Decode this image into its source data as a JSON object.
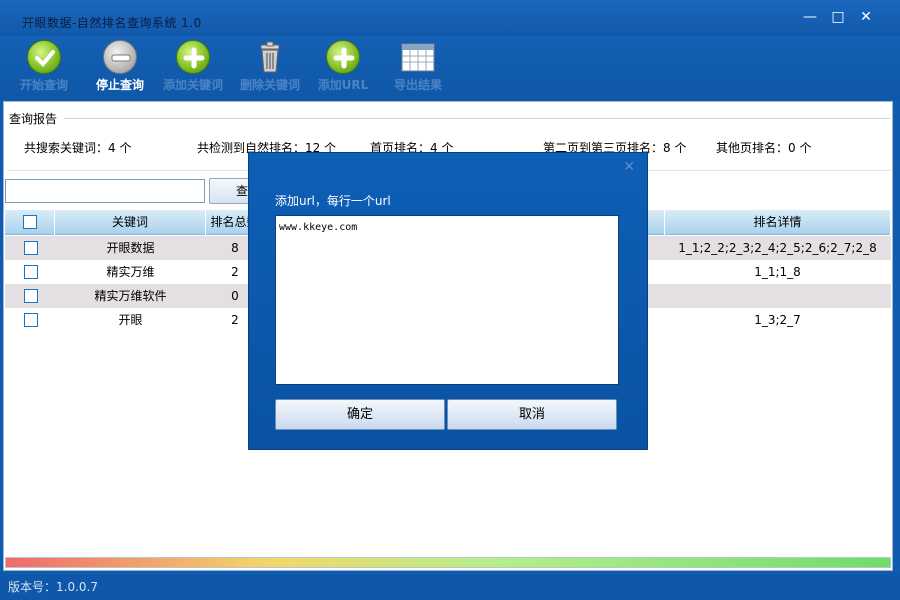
{
  "window": {
    "title": "开眼数据-自然排名查询系统 1.0",
    "min_symbol": "—",
    "max_symbol": "□",
    "close_symbol": "✕"
  },
  "toolbar": {
    "items": [
      {
        "label": "开始查询",
        "icon": "checkmark-icon"
      },
      {
        "label": "停止查询",
        "icon": "stop-icon"
      },
      {
        "label": "添加关键词",
        "icon": "plus-icon"
      },
      {
        "label": "删除关键词",
        "icon": "trash-icon"
      },
      {
        "label": "添加URL",
        "icon": "plus-icon"
      },
      {
        "label": "导出结果",
        "icon": "calendar-table-icon"
      }
    ]
  },
  "report": {
    "title": "查询报告",
    "stats": {
      "total_keywords": "共搜索关键词：4 个",
      "total_ranked": "共检测到自然排名：12 个",
      "first_page": "首页排名：4 个",
      "page2_3": "第二页到第三页排名：8 个",
      "other_pages": "其他页排名：0 个"
    }
  },
  "search": {
    "button_label": "查询",
    "value": ""
  },
  "table": {
    "headers": {
      "keyword": "关键词",
      "rank_total": "排名总数",
      "detail": "排名详情"
    },
    "rows": [
      {
        "keyword": "开眼数据",
        "rank_total": "8",
        "detail": "1_1;2_2;2_3;2_4;2_5;2_6;2_7;2_8"
      },
      {
        "keyword": "精实万维",
        "rank_total": "2",
        "detail": "1_1;1_8"
      },
      {
        "keyword": "精实万维软件",
        "rank_total": "0",
        "detail": ""
      },
      {
        "keyword": "开眼",
        "rank_total": "2",
        "detail": "1_3;2_7"
      }
    ]
  },
  "status": {
    "version": "版本号：1.0.0.7"
  },
  "dialog": {
    "close_symbol": "✕",
    "label": "添加url，每行一个url",
    "textarea_value": "www.kkeye.com",
    "ok_label": "确定",
    "cancel_label": "取消"
  },
  "colors": {
    "chrome_blue": "#0f57a8",
    "header_light_blue": "#a9d2ec",
    "row_alt": "#e4dfe2"
  }
}
